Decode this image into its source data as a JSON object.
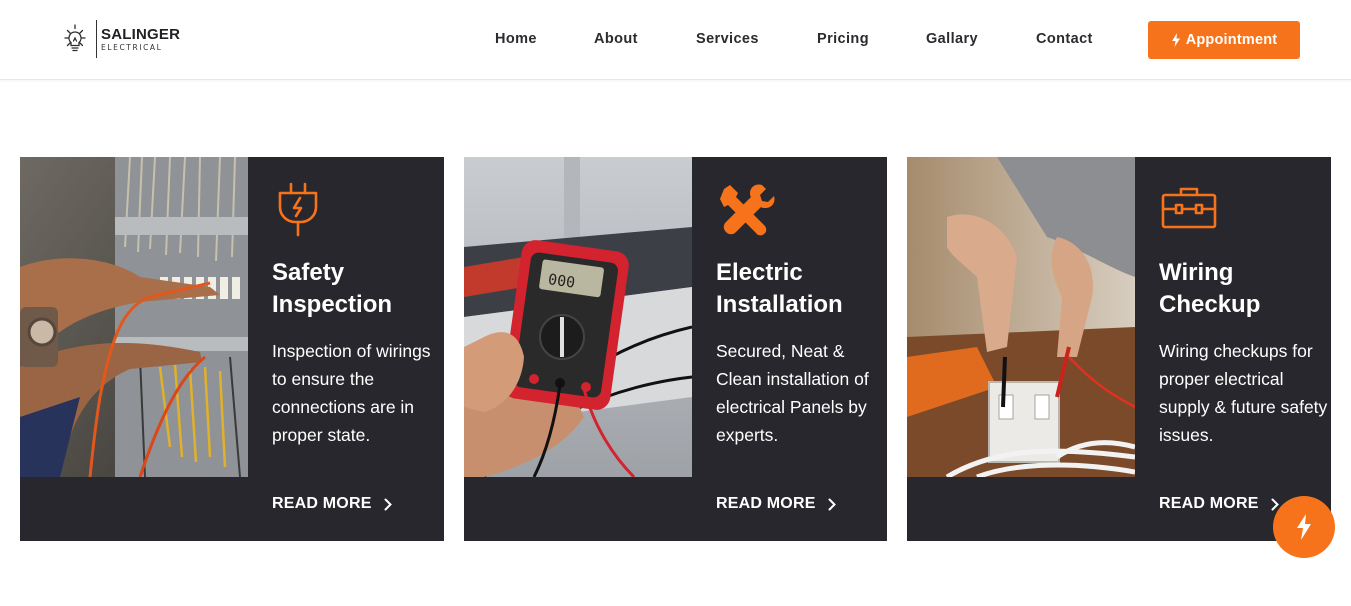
{
  "brand": {
    "name": "SALINGER",
    "subtitle": "ELECTRICAL",
    "accent_color": "#f7731b",
    "card_bg": "#27272d"
  },
  "nav": {
    "items": [
      {
        "label": "Home"
      },
      {
        "label": "About"
      },
      {
        "label": "Services"
      },
      {
        "label": "Pricing"
      },
      {
        "label": "Gallary"
      },
      {
        "label": "Contact"
      }
    ],
    "appointment_label": "Appointment",
    "appointment_icon": "bolt-icon"
  },
  "services": [
    {
      "icon": "plug-icon",
      "title_line1": "Safety",
      "title_line2": "Inspection",
      "description": "Inspection of wirings to ensure the connections are in proper state.",
      "read_more": "READ MORE"
    },
    {
      "icon": "tools-icon",
      "title_line1": "Electric",
      "title_line2": "Installation",
      "description": "Secured, Neat & Clean installation of electrical Panels by experts.",
      "read_more": "READ MORE"
    },
    {
      "icon": "toolbox-icon",
      "title_line1": "Wiring",
      "title_line2": "Checkup",
      "description": "Wiring checkups for proper electrical supply & future safety issues.",
      "read_more": "READ MORE"
    }
  ],
  "floating_button": {
    "icon": "bolt-icon"
  }
}
